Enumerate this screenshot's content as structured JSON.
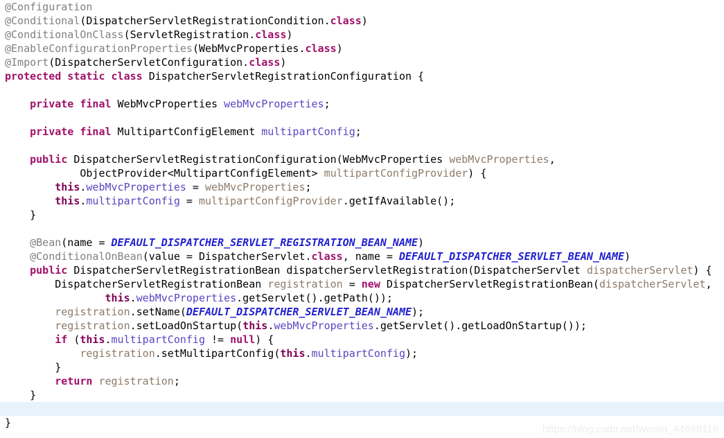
{
  "editor": {
    "language": "java",
    "background_color": "#ffffff",
    "highlight_line_color": "#e8f2fc",
    "colors": {
      "plain": "#000000",
      "keyword": "#a0106a",
      "this_keyword": "#7f0055",
      "annotation": "#808080",
      "field": "#5c44bf",
      "parameter": "#8d7a68",
      "local_variable": "#8d7a68",
      "constant": "#2020d0"
    },
    "highlighted_line_index": 29
  },
  "watermark": {
    "text": "https://blog.csdn.net/weixin_44698119"
  },
  "lines": [
    {
      "index": 0,
      "highlighted": false,
      "tokens": [
        {
          "c": "annotation",
          "t": "@Configuration"
        }
      ]
    },
    {
      "index": 1,
      "highlighted": false,
      "tokens": [
        {
          "c": "annotation",
          "t": "@Conditional"
        },
        {
          "c": "plain",
          "t": "(DispatcherServletRegistrationCondition."
        },
        {
          "c": "keyword",
          "t": "class"
        },
        {
          "c": "plain",
          "t": ")"
        }
      ]
    },
    {
      "index": 2,
      "highlighted": false,
      "tokens": [
        {
          "c": "annotation",
          "t": "@ConditionalOnClass"
        },
        {
          "c": "plain",
          "t": "(ServletRegistration."
        },
        {
          "c": "keyword",
          "t": "class"
        },
        {
          "c": "plain",
          "t": ")"
        }
      ]
    },
    {
      "index": 3,
      "highlighted": false,
      "tokens": [
        {
          "c": "annotation",
          "t": "@EnableConfigurationProperties"
        },
        {
          "c": "plain",
          "t": "(WebMvcProperties."
        },
        {
          "c": "keyword",
          "t": "class"
        },
        {
          "c": "plain",
          "t": ")"
        }
      ]
    },
    {
      "index": 4,
      "highlighted": false,
      "tokens": [
        {
          "c": "annotation",
          "t": "@Import"
        },
        {
          "c": "plain",
          "t": "(DispatcherServletConfiguration."
        },
        {
          "c": "keyword",
          "t": "class"
        },
        {
          "c": "plain",
          "t": ")"
        }
      ]
    },
    {
      "index": 5,
      "highlighted": false,
      "tokens": [
        {
          "c": "keyword",
          "t": "protected static class"
        },
        {
          "c": "plain",
          "t": " DispatcherServletRegistrationConfiguration {"
        }
      ]
    },
    {
      "index": 6,
      "highlighted": false,
      "tokens": []
    },
    {
      "index": 7,
      "highlighted": false,
      "tokens": [
        {
          "c": "plain",
          "t": "    "
        },
        {
          "c": "keyword",
          "t": "private final"
        },
        {
          "c": "plain",
          "t": " WebMvcProperties "
        },
        {
          "c": "field",
          "t": "webMvcProperties"
        },
        {
          "c": "plain",
          "t": ";"
        }
      ]
    },
    {
      "index": 8,
      "highlighted": false,
      "tokens": []
    },
    {
      "index": 9,
      "highlighted": false,
      "tokens": [
        {
          "c": "plain",
          "t": "    "
        },
        {
          "c": "keyword",
          "t": "private final"
        },
        {
          "c": "plain",
          "t": " MultipartConfigElement "
        },
        {
          "c": "field",
          "t": "multipartConfig"
        },
        {
          "c": "plain",
          "t": ";"
        }
      ]
    },
    {
      "index": 10,
      "highlighted": false,
      "tokens": []
    },
    {
      "index": 11,
      "highlighted": false,
      "tokens": [
        {
          "c": "plain",
          "t": "    "
        },
        {
          "c": "keyword",
          "t": "public"
        },
        {
          "c": "plain",
          "t": " DispatcherServletRegistrationConfiguration(WebMvcProperties "
        },
        {
          "c": "param",
          "t": "webMvcProperties"
        },
        {
          "c": "plain",
          "t": ","
        }
      ]
    },
    {
      "index": 12,
      "highlighted": false,
      "tokens": [
        {
          "c": "plain",
          "t": "            ObjectProvider<MultipartConfigElement> "
        },
        {
          "c": "param",
          "t": "multipartConfigProvider"
        },
        {
          "c": "plain",
          "t": ") {"
        }
      ]
    },
    {
      "index": 13,
      "highlighted": false,
      "tokens": [
        {
          "c": "plain",
          "t": "        "
        },
        {
          "c": "this",
          "t": "this"
        },
        {
          "c": "plain",
          "t": "."
        },
        {
          "c": "field",
          "t": "webMvcProperties"
        },
        {
          "c": "plain",
          "t": " = "
        },
        {
          "c": "param",
          "t": "webMvcProperties"
        },
        {
          "c": "plain",
          "t": ";"
        }
      ]
    },
    {
      "index": 14,
      "highlighted": false,
      "tokens": [
        {
          "c": "plain",
          "t": "        "
        },
        {
          "c": "this",
          "t": "this"
        },
        {
          "c": "plain",
          "t": "."
        },
        {
          "c": "field",
          "t": "multipartConfig"
        },
        {
          "c": "plain",
          "t": " = "
        },
        {
          "c": "param",
          "t": "multipartConfigProvider"
        },
        {
          "c": "plain",
          "t": ".getIfAvailable();"
        }
      ]
    },
    {
      "index": 15,
      "highlighted": false,
      "tokens": [
        {
          "c": "plain",
          "t": "    }"
        }
      ]
    },
    {
      "index": 16,
      "highlighted": false,
      "tokens": []
    },
    {
      "index": 17,
      "highlighted": false,
      "tokens": [
        {
          "c": "plain",
          "t": "    "
        },
        {
          "c": "annotation",
          "t": "@Bean"
        },
        {
          "c": "plain",
          "t": "(name = "
        },
        {
          "c": "constant",
          "t": "DEFAULT_DISPATCHER_SERVLET_REGISTRATION_BEAN_NAME"
        },
        {
          "c": "plain",
          "t": ")"
        }
      ]
    },
    {
      "index": 18,
      "highlighted": false,
      "tokens": [
        {
          "c": "plain",
          "t": "    "
        },
        {
          "c": "annotation",
          "t": "@ConditionalOnBean"
        },
        {
          "c": "plain",
          "t": "(value = DispatcherServlet."
        },
        {
          "c": "keyword",
          "t": "class"
        },
        {
          "c": "plain",
          "t": ", name = "
        },
        {
          "c": "constant",
          "t": "DEFAULT_DISPATCHER_SERVLET_BEAN_NAME"
        },
        {
          "c": "plain",
          "t": ")"
        }
      ]
    },
    {
      "index": 19,
      "highlighted": false,
      "tokens": [
        {
          "c": "plain",
          "t": "    "
        },
        {
          "c": "keyword",
          "t": "public"
        },
        {
          "c": "plain",
          "t": " DispatcherServletRegistrationBean dispatcherServletRegistration(DispatcherServlet "
        },
        {
          "c": "param",
          "t": "dispatcherServlet"
        },
        {
          "c": "plain",
          "t": ") {"
        }
      ]
    },
    {
      "index": 20,
      "highlighted": false,
      "tokens": [
        {
          "c": "plain",
          "t": "        DispatcherServletRegistrationBean "
        },
        {
          "c": "local",
          "t": "registration"
        },
        {
          "c": "plain",
          "t": " = "
        },
        {
          "c": "keyword",
          "t": "new"
        },
        {
          "c": "plain",
          "t": " DispatcherServletRegistrationBean("
        },
        {
          "c": "param",
          "t": "dispatcherServlet"
        },
        {
          "c": "plain",
          "t": ","
        }
      ]
    },
    {
      "index": 21,
      "highlighted": false,
      "tokens": [
        {
          "c": "plain",
          "t": "                "
        },
        {
          "c": "this",
          "t": "this"
        },
        {
          "c": "plain",
          "t": "."
        },
        {
          "c": "field",
          "t": "webMvcProperties"
        },
        {
          "c": "plain",
          "t": ".getServlet().getPath());"
        }
      ]
    },
    {
      "index": 22,
      "highlighted": false,
      "tokens": [
        {
          "c": "plain",
          "t": "        "
        },
        {
          "c": "local",
          "t": "registration"
        },
        {
          "c": "plain",
          "t": ".setName("
        },
        {
          "c": "constant",
          "t": "DEFAULT_DISPATCHER_SERVLET_BEAN_NAME"
        },
        {
          "c": "plain",
          "t": ");"
        }
      ]
    },
    {
      "index": 23,
      "highlighted": false,
      "tokens": [
        {
          "c": "plain",
          "t": "        "
        },
        {
          "c": "local",
          "t": "registration"
        },
        {
          "c": "plain",
          "t": ".setLoadOnStartup("
        },
        {
          "c": "this",
          "t": "this"
        },
        {
          "c": "plain",
          "t": "."
        },
        {
          "c": "field",
          "t": "webMvcProperties"
        },
        {
          "c": "plain",
          "t": ".getServlet().getLoadOnStartup());"
        }
      ]
    },
    {
      "index": 24,
      "highlighted": false,
      "tokens": [
        {
          "c": "plain",
          "t": "        "
        },
        {
          "c": "keyword",
          "t": "if"
        },
        {
          "c": "plain",
          "t": " ("
        },
        {
          "c": "this",
          "t": "this"
        },
        {
          "c": "plain",
          "t": "."
        },
        {
          "c": "field",
          "t": "multipartConfig"
        },
        {
          "c": "plain",
          "t": " != "
        },
        {
          "c": "keyword",
          "t": "null"
        },
        {
          "c": "plain",
          "t": ") {"
        }
      ]
    },
    {
      "index": 25,
      "highlighted": false,
      "tokens": [
        {
          "c": "plain",
          "t": "            "
        },
        {
          "c": "local",
          "t": "registration"
        },
        {
          "c": "plain",
          "t": ".setMultipartConfig("
        },
        {
          "c": "this",
          "t": "this"
        },
        {
          "c": "plain",
          "t": "."
        },
        {
          "c": "field",
          "t": "multipartConfig"
        },
        {
          "c": "plain",
          "t": ");"
        }
      ]
    },
    {
      "index": 26,
      "highlighted": false,
      "tokens": [
        {
          "c": "plain",
          "t": "        }"
        }
      ]
    },
    {
      "index": 27,
      "highlighted": false,
      "tokens": [
        {
          "c": "plain",
          "t": "        "
        },
        {
          "c": "keyword",
          "t": "return"
        },
        {
          "c": "plain",
          "t": " "
        },
        {
          "c": "local",
          "t": "registration"
        },
        {
          "c": "plain",
          "t": ";"
        }
      ]
    },
    {
      "index": 28,
      "highlighted": false,
      "tokens": [
        {
          "c": "plain",
          "t": "    }"
        }
      ]
    },
    {
      "index": 29,
      "highlighted": true,
      "tokens": []
    },
    {
      "index": 30,
      "highlighted": false,
      "tokens": [
        {
          "c": "plain",
          "t": "}"
        }
      ]
    }
  ]
}
